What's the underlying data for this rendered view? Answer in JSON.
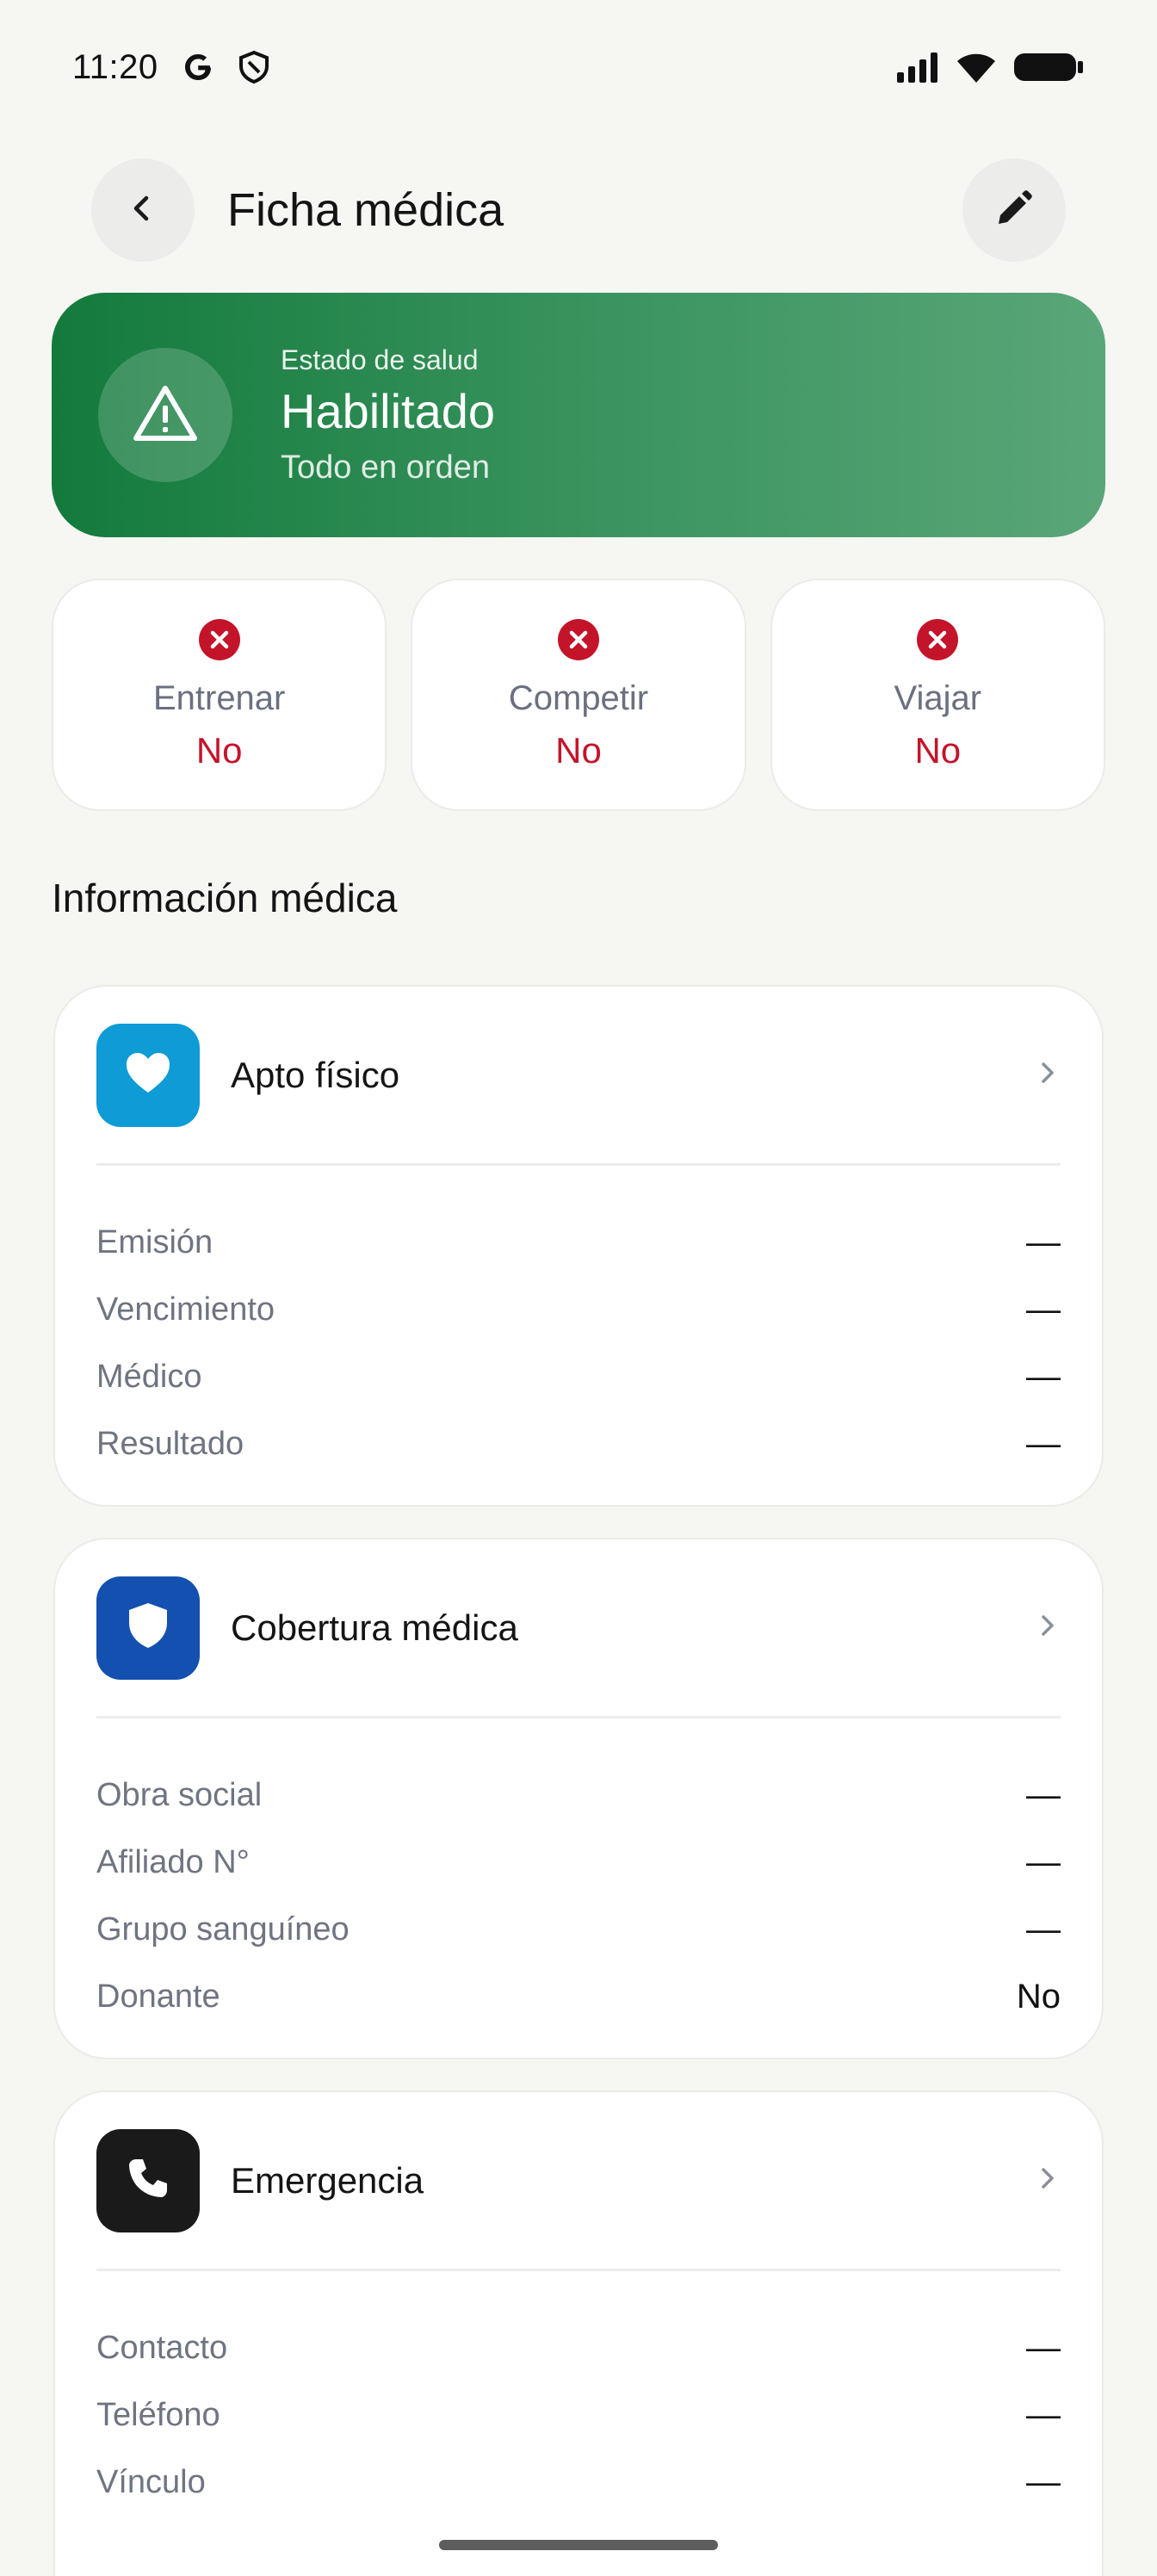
{
  "status_bar": {
    "time": "11:20",
    "icons": [
      "google-icon",
      "shield-icon",
      "signal-icon",
      "wifi-icon",
      "battery-icon"
    ]
  },
  "header": {
    "title": "Ficha médica",
    "back_icon": "chevron-left-icon",
    "edit_icon": "pencil-icon"
  },
  "health": {
    "label": "Estado de salud",
    "status": "Habilitado",
    "subtitle": "Todo en orden",
    "icon": "warning-triangle-icon",
    "colors": {
      "from": "#137a3c",
      "to": "#5aa678"
    }
  },
  "permissions": [
    {
      "label": "Entrenar",
      "value": "No"
    },
    {
      "label": "Competir",
      "value": "No"
    },
    {
      "label": "Viajar",
      "value": "No"
    }
  ],
  "section_title": "Información médica",
  "cards": {
    "apto": {
      "title": "Apto físico",
      "icon": "heart-icon",
      "icon_color": "#0e9bd6",
      "rows": [
        {
          "label": "Emisión",
          "value": "—"
        },
        {
          "label": "Vencimiento",
          "value": "—"
        },
        {
          "label": "Médico",
          "value": "—"
        },
        {
          "label": "Resultado",
          "value": "—"
        }
      ]
    },
    "cobertura": {
      "title": "Cobertura médica",
      "icon": "shield-icon",
      "icon_color": "#1450b0",
      "rows": [
        {
          "label": "Obra social",
          "value": "—"
        },
        {
          "label": "Afiliado N°",
          "value": "—"
        },
        {
          "label": "Grupo sanguíneo",
          "value": "—"
        },
        {
          "label": "Donante",
          "value": "No"
        }
      ]
    },
    "emergencia": {
      "title": "Emergencia",
      "icon": "phone-icon",
      "icon_color": "#1a1a1a",
      "rows": [
        {
          "label": "Contacto",
          "value": "—"
        },
        {
          "label": "Teléfono",
          "value": "—"
        },
        {
          "label": "Vínculo",
          "value": "—"
        }
      ]
    }
  },
  "colors": {
    "negative": "#c4142a",
    "background": "#f6f6f3"
  }
}
